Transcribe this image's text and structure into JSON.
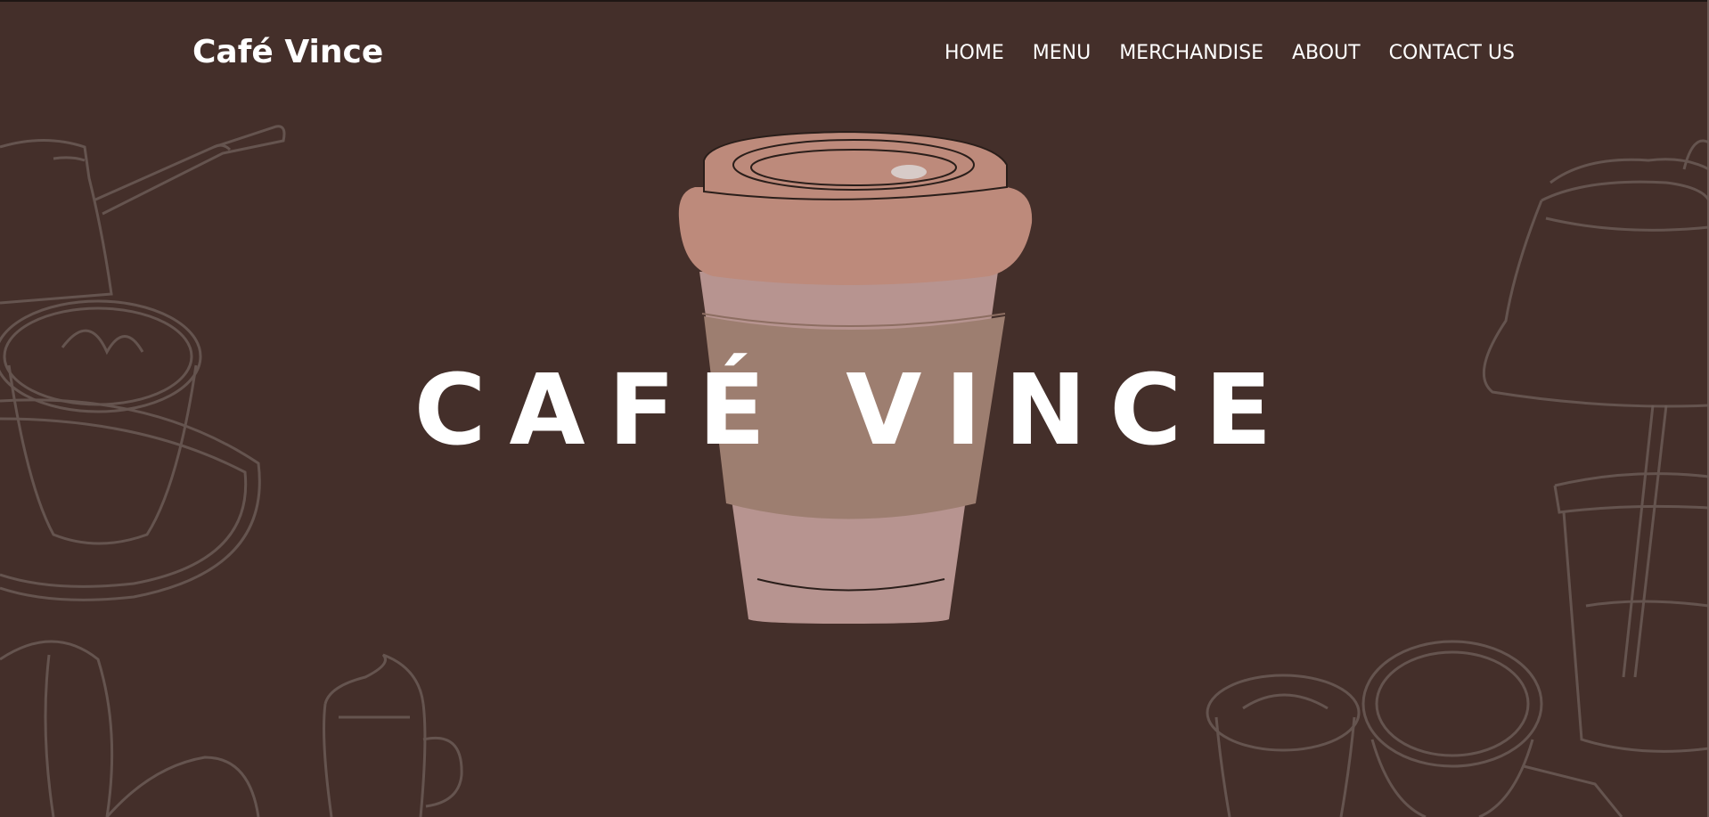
{
  "brand": {
    "logo_text": "Café Vince"
  },
  "nav": {
    "items": [
      {
        "label": "HOME"
      },
      {
        "label": "MENU"
      },
      {
        "label": "MERCHANDISE"
      },
      {
        "label": "ABOUT"
      },
      {
        "label": "CONTACT US"
      }
    ]
  },
  "hero": {
    "title": "CAFÉ VINCE"
  },
  "colors": {
    "background": "#442f2a",
    "cup_lid": "#bd8a7b",
    "cup_body": "#b79490",
    "cup_sleeve": "#9d7e70",
    "sketch_lines": "#6e5e59"
  }
}
